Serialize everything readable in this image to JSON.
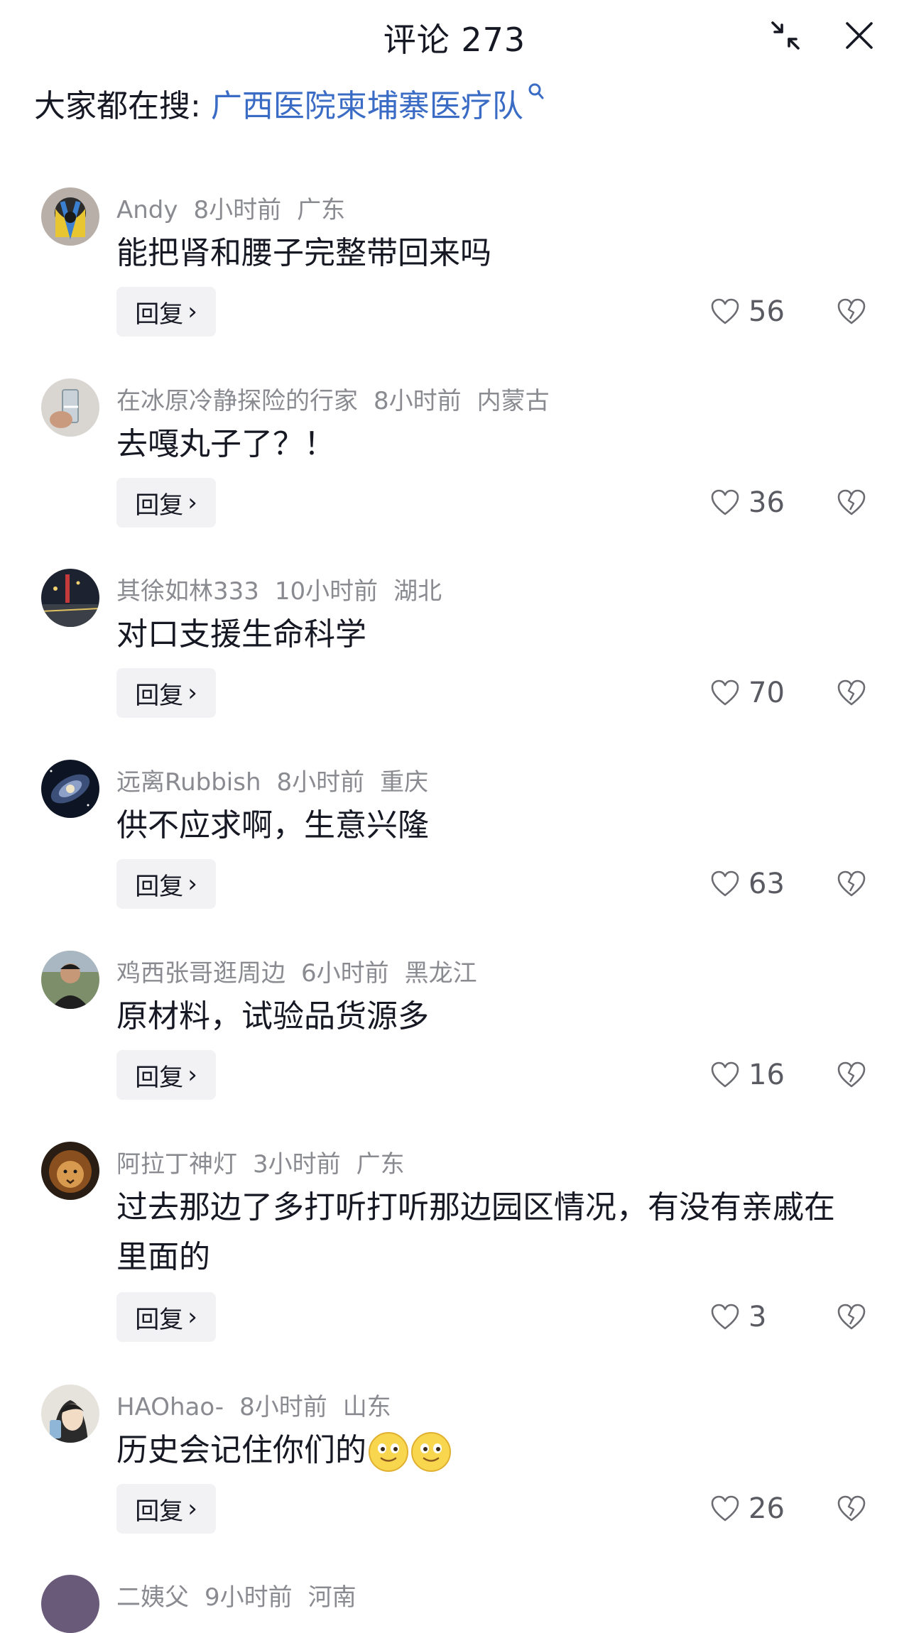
{
  "header": {
    "title": "评论 273"
  },
  "search": {
    "prefix": "大家都在搜:",
    "query": "广西医院柬埔寨医疗队"
  },
  "reply_label": "回复",
  "comments": [
    {
      "user": "Andy",
      "time": "8小时前",
      "location": "广东",
      "text": "能把肾和腰子完整带回来吗",
      "likes": "56"
    },
    {
      "user": "在冰原冷静探险的行家",
      "time": "8小时前",
      "location": "内蒙古",
      "text": "去嘎丸子了？！",
      "likes": "36"
    },
    {
      "user": "其徐如林333",
      "time": "10小时前",
      "location": "湖北",
      "text": "对口支援生命科学",
      "likes": "70"
    },
    {
      "user": "远离Rubbish",
      "time": "8小时前",
      "location": "重庆",
      "text": "供不应求啊，生意兴隆",
      "likes": "63"
    },
    {
      "user": "鸡西张哥逛周边",
      "time": "6小时前",
      "location": "黑龙江",
      "text": "原材料，试验品货源多",
      "likes": "16"
    },
    {
      "user": "阿拉丁神灯",
      "time": "3小时前",
      "location": "广东",
      "text": "过去那边了多打听打听那边园区情况，有没有亲戚在里面的",
      "likes": "3"
    },
    {
      "user": "HAOhao-",
      "time": "8小时前",
      "location": "山东",
      "text": "历史会记住你们的",
      "likes": "26"
    },
    {
      "user": "二姨父",
      "time": "9小时前",
      "location": "河南",
      "text": "",
      "likes": ""
    }
  ]
}
